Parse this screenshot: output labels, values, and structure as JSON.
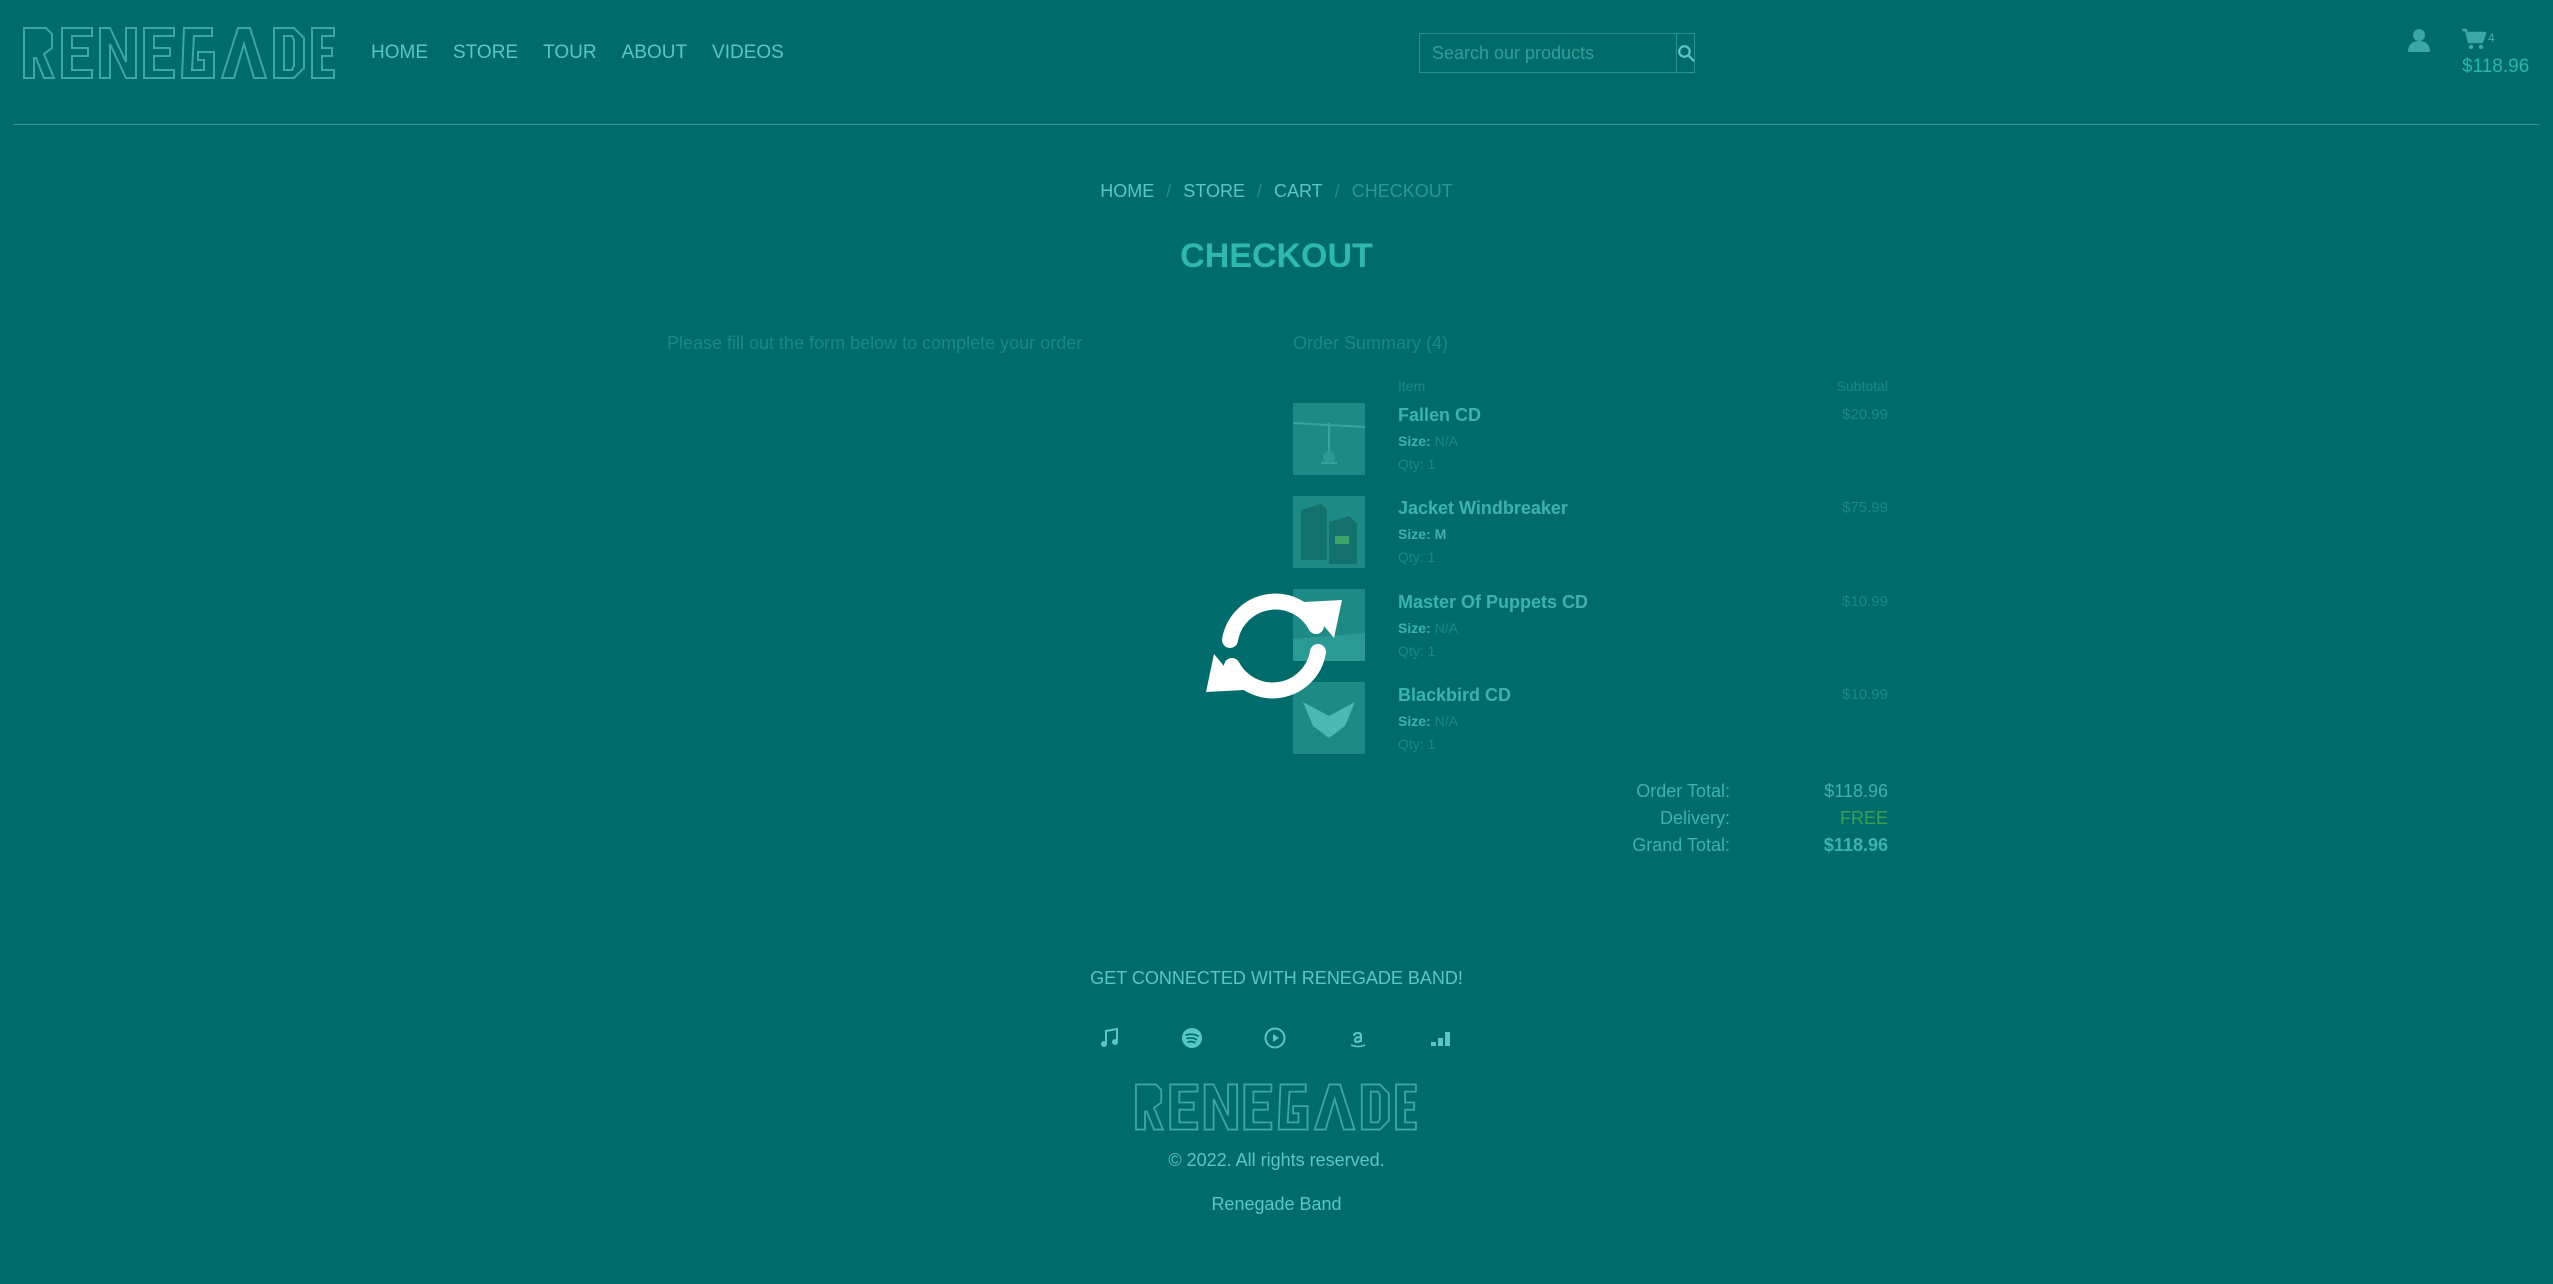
{
  "header": {
    "logo_text": "RENEGADE",
    "nav": [
      "HOME",
      "STORE",
      "TOUR",
      "ABOUT",
      "VIDEOS"
    ],
    "search_placeholder": "Search our products",
    "cart_count": "4",
    "cart_total": "$118.96"
  },
  "breadcrumb": {
    "items": [
      "HOME",
      "STORE",
      "CART"
    ],
    "separator": "/",
    "current": "CHECKOUT"
  },
  "page_title": "CHECKOUT",
  "form_intro": "Please fill out the form below to complete your order",
  "summary": {
    "title": "Order Summary (4)",
    "col_item": "Item",
    "col_subtotal": "Subtotal",
    "size_label": "Size:",
    "items": [
      {
        "name": "Fallen CD",
        "size": "N/A",
        "qty": "Qty: 1",
        "price": "$20.99"
      },
      {
        "name": "Jacket Windbreaker",
        "size": "M",
        "qty": "Qty: 1",
        "price": "$75.99"
      },
      {
        "name": "Master Of Puppets CD",
        "size": "N/A",
        "qty": "Qty: 1",
        "price": "$10.99"
      },
      {
        "name": "Blackbird CD",
        "size": "N/A",
        "qty": "Qty: 1",
        "price": "$10.99"
      }
    ],
    "order_total_label": "Order Total:",
    "order_total": "$118.96",
    "delivery_label": "Delivery:",
    "delivery": "FREE",
    "grand_total_label": "Grand Total:",
    "grand_total": "$118.96"
  },
  "footer": {
    "heading": "GET CONNECTED WITH RENEGADE BAND!",
    "social_icons": [
      "music-note-icon",
      "spotify-icon",
      "play-icon",
      "amazon-icon",
      "deezer-icon"
    ],
    "logo_text": "RENEGADE",
    "copyright": "© 2022. All rights reserved.",
    "band": "Renegade Band"
  },
  "colors": {
    "overlay": "#006b6b",
    "accent": "#2fb7b0",
    "free": "#3d9f55",
    "spinner": "#ffffff"
  }
}
